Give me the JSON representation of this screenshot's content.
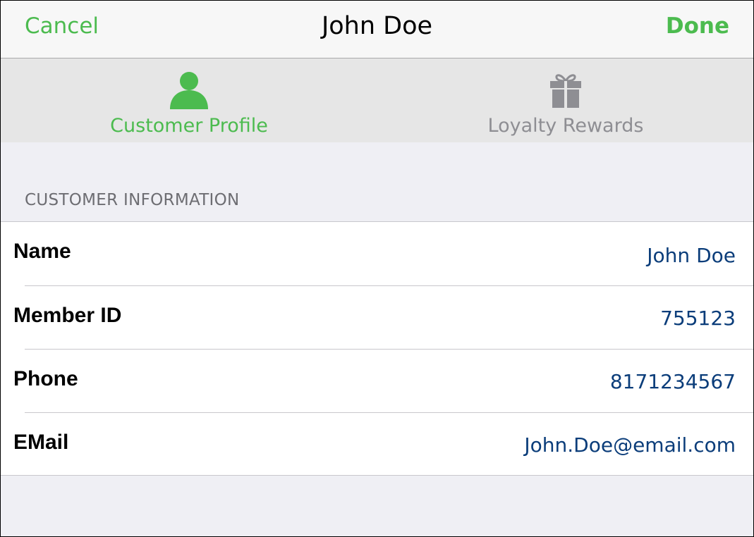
{
  "nav": {
    "cancel_label": "Cancel",
    "title": "John Doe",
    "done_label": "Done"
  },
  "tabs": [
    {
      "label": "Customer Profile",
      "icon": "person-icon",
      "selected": true
    },
    {
      "label": "Loyalty Rewards",
      "icon": "gift-icon",
      "selected": false
    }
  ],
  "section": {
    "header": "CUSTOMER INFORMATION"
  },
  "fields": [
    {
      "label": "Name",
      "value": "John Doe"
    },
    {
      "label": "Member ID",
      "value": "755123"
    },
    {
      "label": "Phone",
      "value": "8171234567"
    },
    {
      "label": "EMail",
      "value": "John.Doe@email.com"
    }
  ],
  "colors": {
    "accent_green": "#4cbb4f",
    "value_blue": "#0b3d7a",
    "inactive_gray": "#8e8e93"
  }
}
